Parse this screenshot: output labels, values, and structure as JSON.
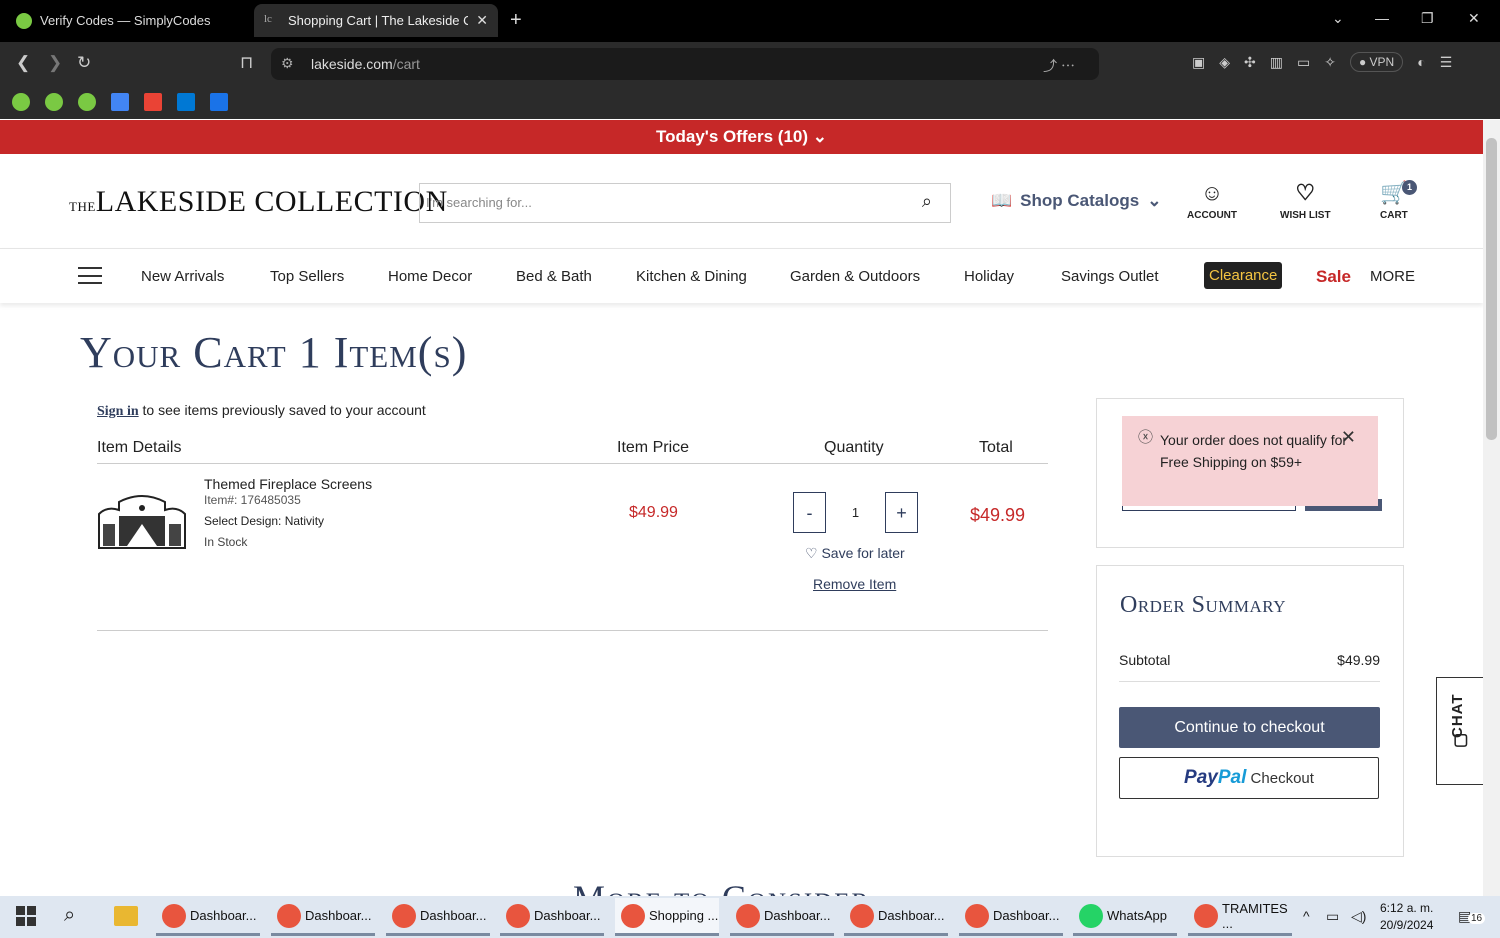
{
  "browser": {
    "tabs": [
      {
        "title": "Verify Codes — SimplyCodes",
        "active": false
      },
      {
        "title": "Shopping Cart | The Lakeside C",
        "active": true
      }
    ],
    "url_domain": "lakeside.com",
    "url_path": "/cart",
    "vpn_label": "VPN"
  },
  "site": {
    "offers_banner": "Today's Offers (10)",
    "logo_the": "THE",
    "logo_name": "LAKESIDE COLLECTION",
    "search_placeholder": "I'm searching for...",
    "shop_catalogs": "Shop Catalogs",
    "account_label": "ACCOUNT",
    "wishlist_label": "WISH LIST",
    "cart_label": "CART",
    "cart_count": "1",
    "nav": [
      "New Arrivals",
      "Top Sellers",
      "Home Decor",
      "Bed & Bath",
      "Kitchen & Dining",
      "Garden & Outdoors",
      "Holiday",
      "Savings Outlet"
    ],
    "clearance": "Clearance",
    "sale": "Sale",
    "more": "MORE"
  },
  "cart": {
    "title": "Your Cart 1 Item(s)",
    "sign_in_link": "Sign in",
    "sign_in_text": " to see items previously saved to your account",
    "headers": {
      "details": "Item Details",
      "price": "Item Price",
      "quantity": "Quantity",
      "total": "Total"
    },
    "item": {
      "name": "Themed Fireplace Screens",
      "item_no": "Item#: 176485035",
      "design": "Select Design: Nativity",
      "stock": "In Stock",
      "price": "$49.99",
      "quantity": "1",
      "total": "$49.99",
      "save_for_later": "Save for later",
      "remove": "Remove Item"
    },
    "minus": "-",
    "plus": "+"
  },
  "promo": {
    "alert_line1": "Your order does not qualify for",
    "alert_line2": "Free Shipping on $59+"
  },
  "summary": {
    "title": "Order Summary",
    "subtotal_label": "Subtotal",
    "subtotal_value": "$49.99",
    "checkout": "Continue to checkout",
    "paypal_1": "Pay",
    "paypal_2": "Pal",
    "paypal_checkout": " Checkout"
  },
  "chat_label": "CHAT",
  "more_title": "More to Consider",
  "taskbar": {
    "apps": [
      "Dashboar...",
      "Dashboar...",
      "Dashboar...",
      "Dashboar...",
      "Shopping ...",
      "Dashboar...",
      "Dashboar...",
      "Dashboar...",
      "WhatsApp",
      "TRAMITES ..."
    ],
    "time": "6:12 a. m.",
    "date": "20/9/2024",
    "notif_count": "16"
  }
}
